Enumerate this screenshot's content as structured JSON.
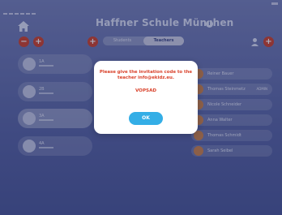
{
  "header": {
    "school_title": "Haffner Schule München",
    "info_icon": "i"
  },
  "tabs": [
    {
      "label": "Students"
    },
    {
      "label": "Teachers"
    }
  ],
  "classes": [
    {
      "name": "1A"
    },
    {
      "name": "2B"
    },
    {
      "name": "3A"
    },
    {
      "name": "4A"
    }
  ],
  "teachers": [
    {
      "name": "Reiner Bauer"
    },
    {
      "name": "Thomas Steinmetz",
      "tag": "ADMIN"
    },
    {
      "name": "Nicole Schneider"
    },
    {
      "name": "Anna Walter"
    },
    {
      "name": "Thomas Schmidt"
    },
    {
      "name": "Sarah Seibel"
    }
  ],
  "modal": {
    "message": "Please give the invitation code to the teacher info@ekidz.eu.",
    "code": "VOPSAD",
    "ok_label": "OK"
  },
  "colors": {
    "background": "#6a76ad",
    "accent_red": "#d9422b",
    "ok_blue": "#34aee6"
  }
}
